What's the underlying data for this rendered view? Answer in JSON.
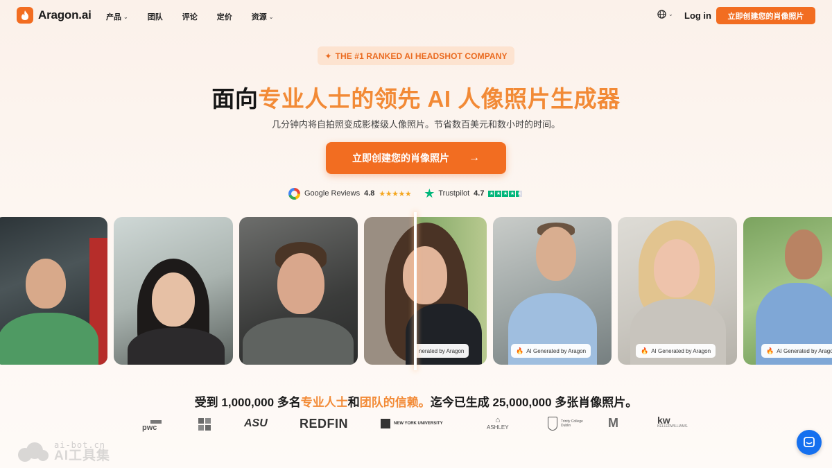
{
  "nav": {
    "logo_text": "Aragon.ai",
    "links": [
      {
        "label": "产品",
        "has_dropdown": true
      },
      {
        "label": "团队",
        "has_dropdown": false
      },
      {
        "label": "评论",
        "has_dropdown": false
      },
      {
        "label": "定价",
        "has_dropdown": false
      },
      {
        "label": "资源",
        "has_dropdown": true
      }
    ],
    "login_label": "Log in",
    "cta_label": "立即创建您的肖像照片"
  },
  "hero": {
    "badge": "THE #1 RANKED AI HEADSHOT COMPANY",
    "headline_prefix": "面向",
    "headline_accent": "专业人士的领先 AI 人像照片生成器",
    "subhead": "几分钟内将自拍照变成影楼级人像照片。节省数百美元和数小时的时间。",
    "cta_label": "立即创建您的肖像照片",
    "cta_arrow": "→"
  },
  "reviews": {
    "google_label": "Google Reviews",
    "google_score": "4.8",
    "google_stars": "★★★★★",
    "trustpilot_label": "Trustpilot",
    "trustpilot_score": "4.7"
  },
  "photos": {
    "ai_tag": "AI Generated by Aragon",
    "ai_tag_cropped": "nerated by Aragon"
  },
  "trust": {
    "p1": "受到 1,000,000 多名",
    "a1": "专业人士",
    "p2": "和",
    "a2": "团队的信赖。",
    "p3": "迄今已生成 25,000,000 多张肖像照片。"
  },
  "logos": {
    "pwc": "pwc",
    "asu": "ASU",
    "redfin": "REDFIN",
    "nyu": "NEW YORK UNIVERSITY",
    "ashley": "ASHLEY",
    "tcd": "Trinity College Dublin",
    "michigan": "M",
    "kw": "kw",
    "kw_sub": "KELLERWILLIAMS."
  },
  "watermark": {
    "url": "ai-bot.cn",
    "name": "AI工具集"
  },
  "colors": {
    "brand_orange": "#f26d21",
    "accent_orange": "#f28a36",
    "chat_blue": "#1570ef"
  }
}
